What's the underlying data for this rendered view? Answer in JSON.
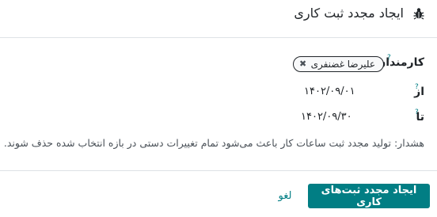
{
  "dialog": {
    "title": "ایجاد مجدد ثبت کاری",
    "icon": "bug-icon"
  },
  "fields": {
    "employees": {
      "label": "کارمندان",
      "help": "?",
      "tags": [
        {
          "label": "علیرضا غضنفری",
          "remove_icon": "close-icon"
        }
      ]
    },
    "from": {
      "label": "از",
      "help": "?",
      "value": "۱۴۰۲/۰۹/۰۱"
    },
    "to": {
      "label": "تا",
      "help": "?",
      "value": "۱۴۰۲/۰۹/۳۰"
    }
  },
  "warning": "هشدار: تولید مجدد ثبت ساعات کار باعث می‌شود تمام تغییرات دستی در بازه انتخاب شده حذف شوند.",
  "footer": {
    "primary_label": "ایجاد مجدد ثبت‌های کاری",
    "cancel_label": "لغو"
  },
  "colors": {
    "accent": "#017e84",
    "text": "#212529",
    "muted": "#495057",
    "divider": "#dee2e6"
  }
}
